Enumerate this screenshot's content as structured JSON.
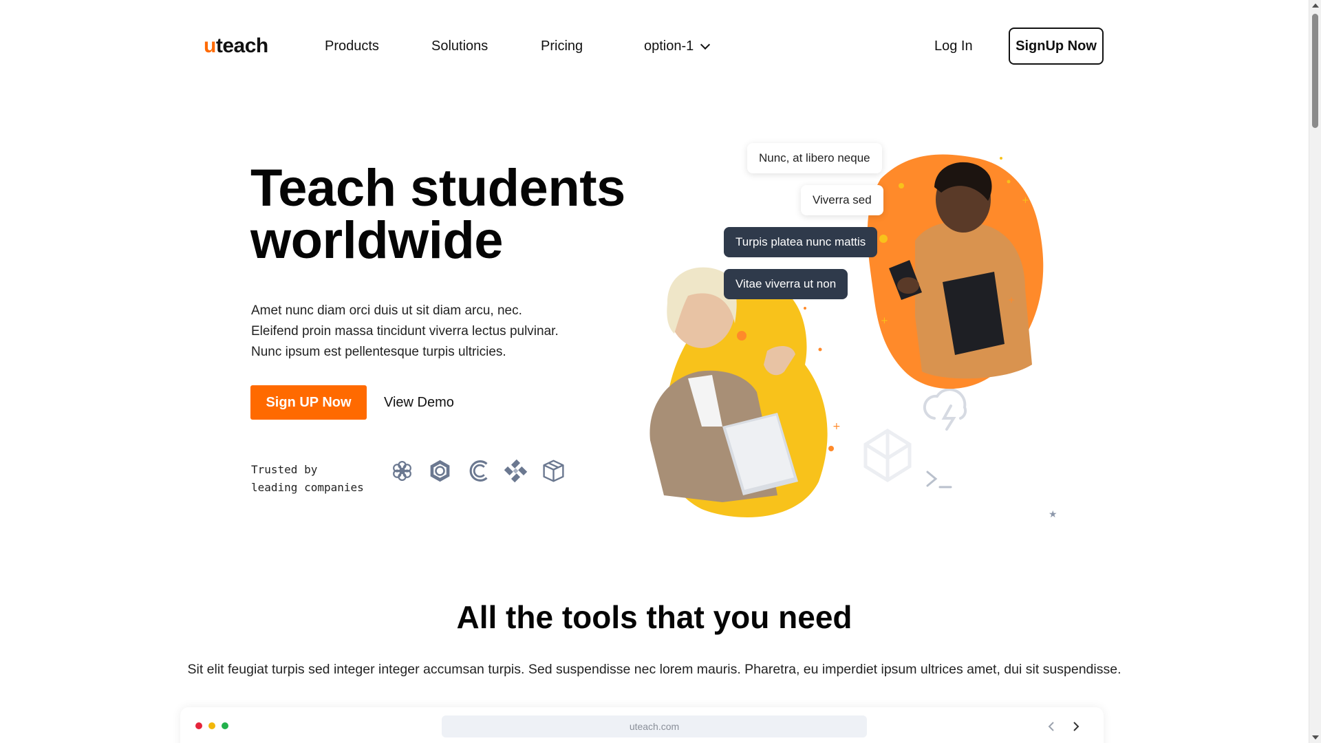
{
  "header": {
    "logo_mark": "u",
    "logo_text": "teach",
    "nav": [
      "Products",
      "Solutions",
      "Pricing",
      "option-1"
    ],
    "login_label": "Log In",
    "signup_label": "SignUp Now"
  },
  "hero": {
    "title_line1": "Teach students",
    "title_line2": "worldwide",
    "description": [
      "Amet nunc diam orci duis ut sit diam arcu, nec.",
      "Eleifend proin massa tincidunt viverra lectus pulvinar.",
      "Nunc ipsum est pellentesque turpis ultricies."
    ],
    "primary_cta": "Sign UP Now",
    "secondary_cta": "View Demo",
    "trusted_line1": "Trusted by",
    "trusted_line2": "leading companies",
    "company_logo_icons": [
      "flower-icon",
      "hexagon-icon",
      "c-arc-icon",
      "x-cross-icon",
      "cube-icon"
    ]
  },
  "chat": [
    {
      "text": "Nunc, at libero neque",
      "style": "light"
    },
    {
      "text": "Viverra sed",
      "style": "light"
    },
    {
      "text": "Turpis platea nunc mattis",
      "style": "dark"
    },
    {
      "text": "Vitae viverra ut non",
      "style": "dark"
    }
  ],
  "tools": {
    "title": "All the tools that you need",
    "description": "Sit elit feugiat turpis sed integer integer accumsan turpis. Sed suspendisse nec lorem mauris. Pharetra, eu imperdiet ipsum ultrices amet, dui sit suspendisse."
  },
  "browser_mock": {
    "url": "uteach.com"
  },
  "colors": {
    "accent": "#ff6a00",
    "dark_bubble": "#2f3a4b",
    "blob_yellow": "#f8c21b",
    "blob_orange": "#ff8a2a"
  }
}
